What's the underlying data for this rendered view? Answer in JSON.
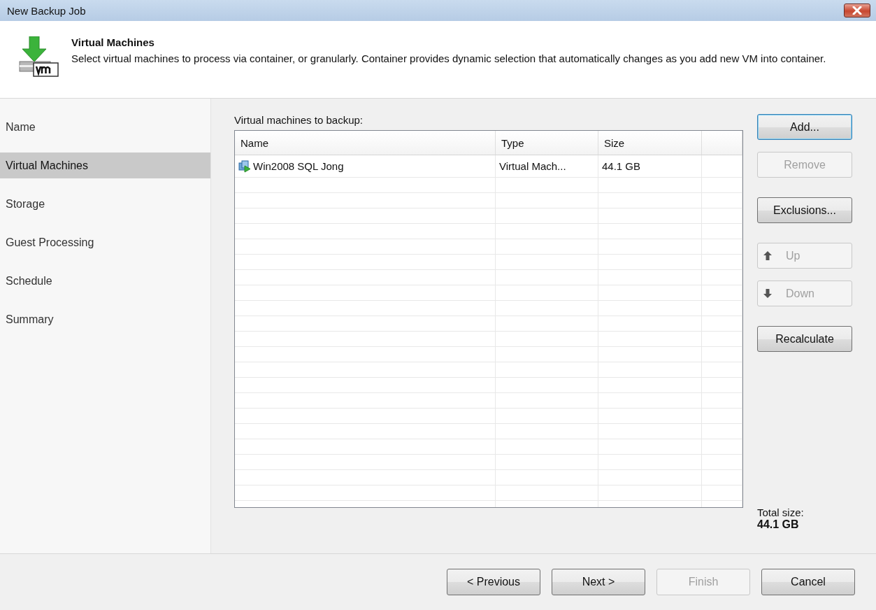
{
  "window": {
    "title": "New Backup Job"
  },
  "header": {
    "title": "Virtual Machines",
    "description": "Select virtual machines to process via container, or granularly. Container provides dynamic selection that automatically changes as you add new VM into container."
  },
  "sidebar": {
    "items": [
      {
        "label": "Name",
        "selected": false
      },
      {
        "label": "Virtual Machines",
        "selected": true
      },
      {
        "label": "Storage",
        "selected": false
      },
      {
        "label": "Guest Processing",
        "selected": false
      },
      {
        "label": "Schedule",
        "selected": false
      },
      {
        "label": "Summary",
        "selected": false
      }
    ]
  },
  "table": {
    "label": "Virtual machines to backup:",
    "columns": [
      "Name",
      "Type",
      "Size"
    ],
    "rows": [
      {
        "name": "Win2008 SQL Jong",
        "type": "Virtual Mach...",
        "size": "44.1 GB"
      }
    ]
  },
  "side_buttons": [
    {
      "label": "Add...",
      "kind": "plain",
      "disabled": false,
      "focused": true
    },
    {
      "label": "Remove",
      "kind": "plain",
      "disabled": true,
      "focused": false
    },
    {
      "label": "Exclusions...",
      "kind": "plain",
      "disabled": false,
      "focused": false
    },
    {
      "label": "Up",
      "kind": "up",
      "disabled": true,
      "focused": false
    },
    {
      "label": "Down",
      "kind": "down",
      "disabled": true,
      "focused": false
    },
    {
      "label": "Recalculate",
      "kind": "plain",
      "disabled": false,
      "focused": false
    }
  ],
  "total": {
    "label": "Total size:",
    "value": "44.1 GB"
  },
  "footer_buttons": [
    {
      "label": "< Previous",
      "disabled": false
    },
    {
      "label": "Next >",
      "disabled": false
    },
    {
      "label": "Finish",
      "disabled": true
    },
    {
      "label": "Cancel",
      "disabled": false
    }
  ]
}
